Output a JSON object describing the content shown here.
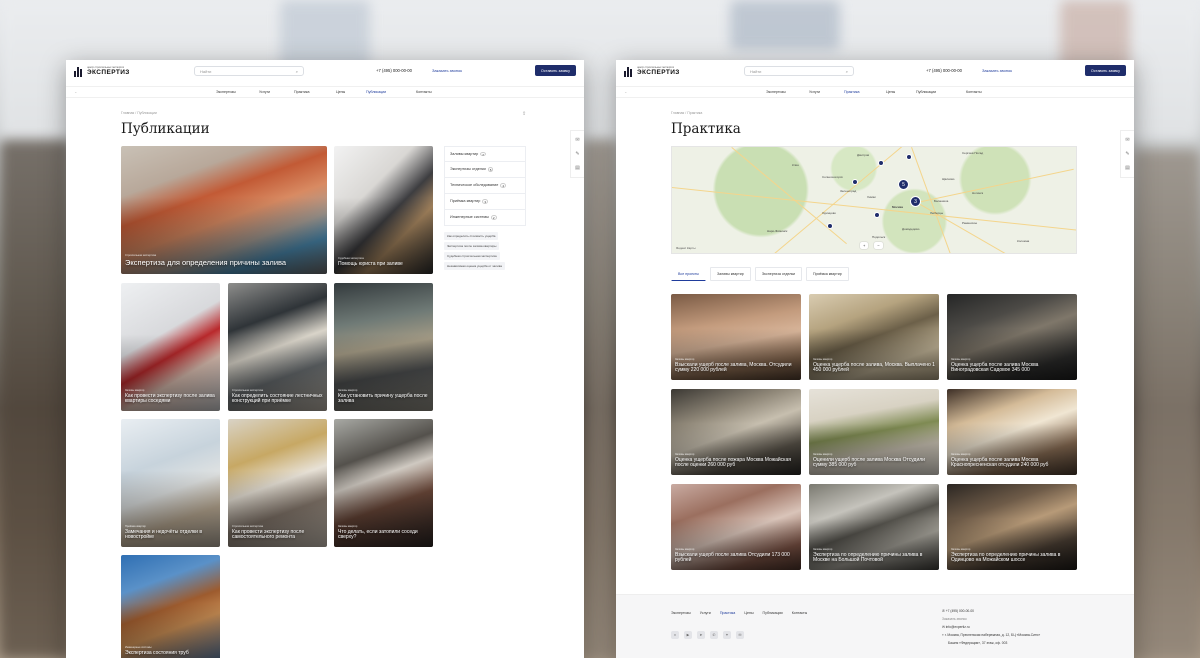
{
  "colors": {
    "brand": "#1f2d6b",
    "accent": "#1f3c9c",
    "background_panel": "#ffffff"
  },
  "site": {
    "logo_subtitle": "центр строительных экспертиз",
    "logo_name": "ЭКСПЕРТИЗ",
    "search_placeholder": "Найти",
    "search_icon": "search-icon",
    "phone": "+7 (495) 000-00-00",
    "callback": "Заказать звонок",
    "cta": "Оставить заявку",
    "nav": [
      "Экспертизы",
      "Услуги",
      "Практика",
      "Цены",
      "Публикации",
      "Контакты"
    ]
  },
  "publications": {
    "breadcrumb": [
      "Главная",
      "Публикации"
    ],
    "title": "Публикации",
    "filters": [
      {
        "label": "Заливы квартир",
        "count": "7"
      },
      {
        "label": "Экспертизы отделки",
        "count": "5"
      },
      {
        "label": "Техническое обследование",
        "count": "4"
      },
      {
        "label": "Приёмка квартир",
        "count": "3"
      },
      {
        "label": "Инженерные системы",
        "count": "2"
      }
    ],
    "chips": [
      "Как определить стоимость ущерба",
      "Экспертиза после залива квартиры",
      "Судебная строительная экспертиза",
      "Независимая оценка ущерба от залива"
    ],
    "cards": [
      {
        "tag": "Строительная экспертиза",
        "title": "Экспертиза для определения причины залива"
      },
      {
        "tag": "Судебная экспертиза",
        "title": "Помощь юриста при заливе"
      },
      {
        "tag": "Заливы квартир",
        "title": "Как провести экспертизу после залива квартиры соседями"
      },
      {
        "tag": "Строительная экспертиза",
        "title": "Как определить состояние лестничных конструкций при приёмке"
      },
      {
        "tag": "Заливы квартир",
        "title": "Как установить причину ущерба после залива"
      },
      {
        "tag": "Приёмка квартир",
        "title": "Замечания и недочёты отделки в новостройке"
      },
      {
        "tag": "Строительная экспертиза",
        "title": "Как провести экспертизу после самостоятельного ремонта"
      },
      {
        "tag": "Заливы квартир",
        "title": "Что делать, если затопили соседи сверху?"
      },
      {
        "tag": "Инженерные системы",
        "title": "Экспертиза состояния труб"
      }
    ]
  },
  "practice": {
    "breadcrumb": [
      "Главная",
      "Практика"
    ],
    "title": "Практика",
    "map": {
      "cities": [
        "Дмитров",
        "Сергиев Посад",
        "Клин",
        "Солнечногорск",
        "Зеленоград",
        "Химки",
        "Москва",
        "Одинцово",
        "Подольск",
        "Раменское",
        "Ногинск",
        "Щёлково",
        "Балашиха",
        "Домодедово",
        "Наро-Фоминск",
        "Коломна",
        "Люберцы"
      ],
      "cluster_counts": [
        "5",
        "3"
      ],
      "scale": "Яндекс Карты",
      "zoom_in": "+",
      "zoom_out": "−"
    },
    "tabs": [
      "Все проекты",
      "Заливы квартир",
      "Экспертиза отделки",
      "Приёмка квартир"
    ],
    "cards": [
      {
        "tag": "Заливы квартир",
        "title": "Взыскали ущерб после залива, Москва. Отсудили сумму 220 000 рублей"
      },
      {
        "tag": "Заливы квартир",
        "title": "Оценка ущерба после залива, Москва. Выплачено 1 450 000 рублей"
      },
      {
        "tag": "Заливы квартир",
        "title": "Оценка ущерба после залива Москва Виноградовская Садовое 345 000"
      },
      {
        "tag": "Заливы квартир",
        "title": "Оценка ущерба после пожара Москва Можайская после оценки 260 000 руб"
      },
      {
        "tag": "Заливы квартир",
        "title": "Оценили ущерб после залива Москва Отсудили сумму 385 000 руб"
      },
      {
        "tag": "Заливы квартир",
        "title": "Оценка ущерба после залива Москва Краснопресненская отсудили 240 000 руб"
      },
      {
        "tag": "Заливы квартир",
        "title": "Взыскали ущерб после залива Отсудили 173 000 рублей"
      },
      {
        "tag": "Заливы квартир",
        "title": "Экспертиза по определению причины залива в Москве на Большой Почтовой"
      },
      {
        "tag": "Заливы квартир",
        "title": "Экспертиза по определению причины залива в Одинцово на Можайском шоссе"
      }
    ]
  },
  "footer": {
    "nav": [
      "Экспертизы",
      "Услуги",
      "Практика",
      "Цены",
      "Публикации",
      "Контакты"
    ],
    "social": [
      "vk-icon",
      "youtube-icon",
      "telegram-icon",
      "whatsapp-icon",
      "dzen-icon",
      "mail-icon"
    ],
    "phone": "+7 (495) 000-00-00",
    "callback": "Заказать звонок",
    "email": "info@expertiz.ru",
    "address": "г. Москва, Пресненская набережная, д. 12, БЦ «Москва-Сити»",
    "address2": "Башня «Федерация», 37 этаж, оф. 003"
  }
}
